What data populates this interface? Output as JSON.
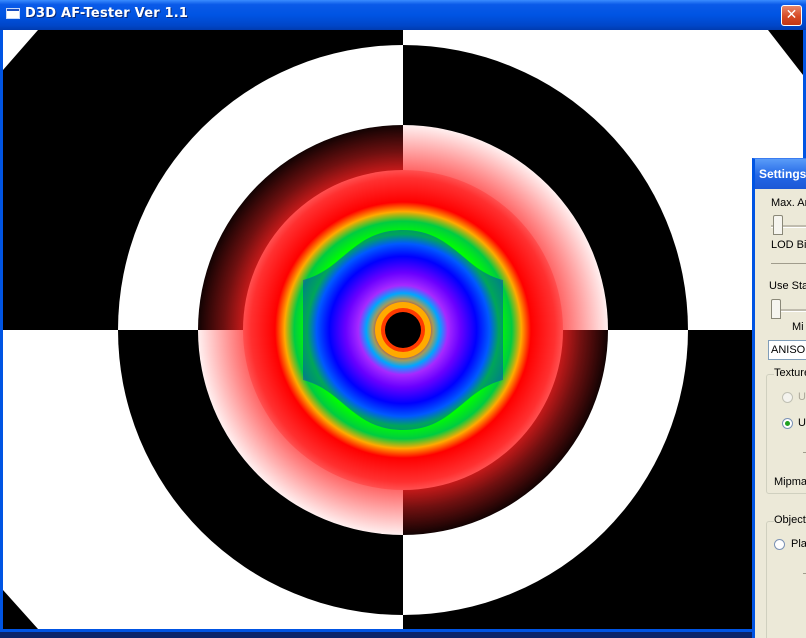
{
  "window": {
    "title": "D3D AF-Tester Ver 1.1",
    "close_glyph": "✕"
  },
  "viewport": {
    "description_colors": {
      "black": "#000000",
      "white": "#ffffff"
    },
    "rainbow_colors": [
      "#000000",
      "#ff8800",
      "#ffff00",
      "#00ffff",
      "#ff00ff",
      "#0000ff",
      "#00ff00",
      "#ff0000"
    ]
  },
  "settings": {
    "title": "Settings",
    "max_aniso_label": "Max. Ar",
    "lod_bias_label": "LOD Bi",
    "use_stage_label": "Use Sta",
    "min_label": "Mi",
    "filter_value": "ANISO",
    "texture_group_label": "Texture",
    "texture_radio_1_label": "U",
    "texture_radio_2_label": "U",
    "mipmap_label": "Mipmap",
    "object_group_label": "Object",
    "object_radio_label": "Plar"
  }
}
